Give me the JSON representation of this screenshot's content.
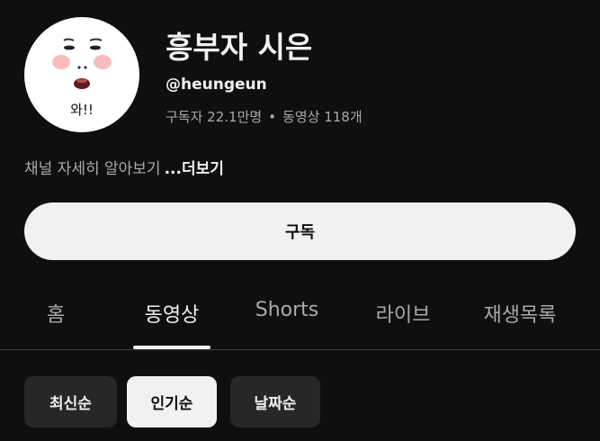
{
  "channel": {
    "name": "흥부자 시은",
    "handle": "@heungeun",
    "subscribers": "구독자 22.1만명",
    "separator": "•",
    "video_count": "동영상 118개",
    "about": "채널 자세히 알아보기",
    "more": "...더보기",
    "avatar_caption": "와!!"
  },
  "subscribe_label": "구독",
  "tabs": [
    {
      "label": "홈",
      "active": false
    },
    {
      "label": "동영상",
      "active": true
    },
    {
      "label": "Shorts",
      "active": false
    },
    {
      "label": "라이브",
      "active": false
    },
    {
      "label": "재생목록",
      "active": false
    }
  ],
  "sort_chips": [
    {
      "label": "최신순",
      "selected": false
    },
    {
      "label": "인기순",
      "selected": true
    },
    {
      "label": "날짜순",
      "selected": false
    }
  ],
  "colors": {
    "background": "#0f0f0f",
    "primary_text": "#f1f1f1",
    "secondary_text": "#aaaaaa",
    "chip_background": "#272727"
  }
}
